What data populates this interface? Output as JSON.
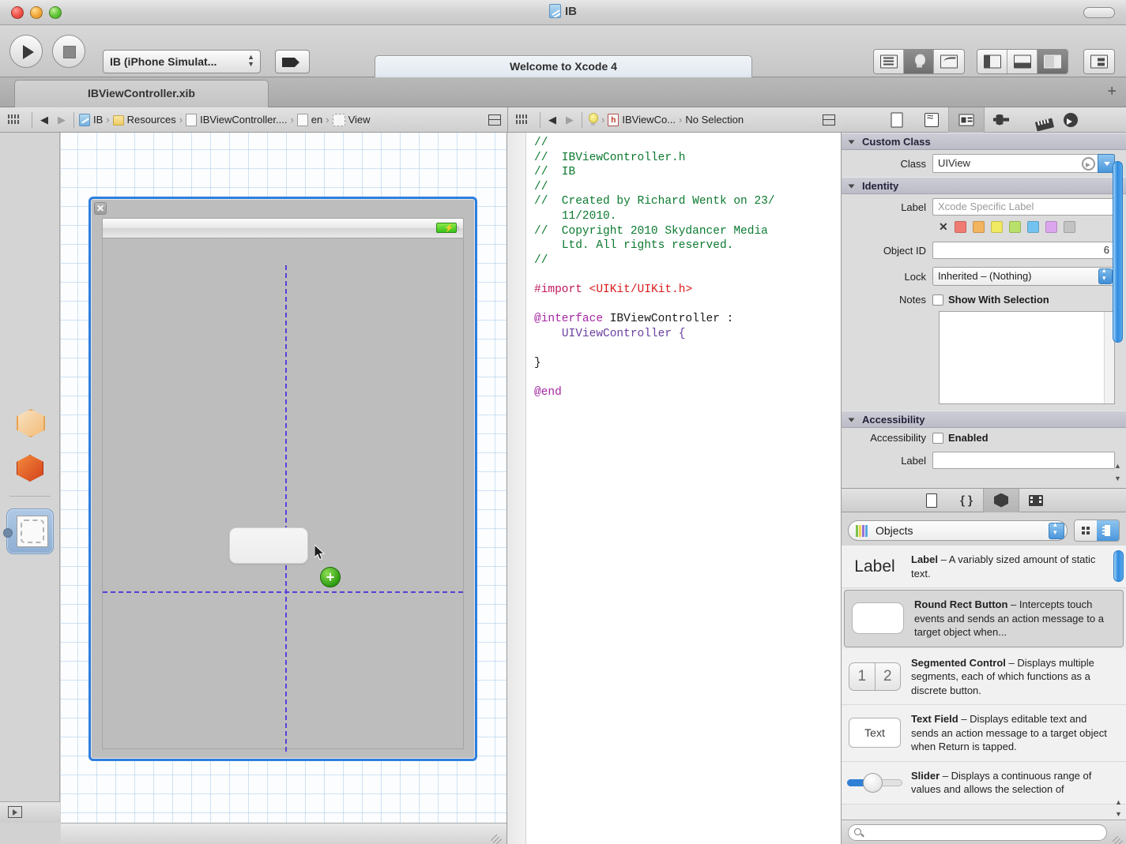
{
  "window": {
    "title": "IB",
    "traffic_lights": [
      "close",
      "minimize",
      "zoom"
    ]
  },
  "toolbar": {
    "run_label": "Run",
    "stop_label": "Stop",
    "scheme": "IB (iPhone Simulat...",
    "breakpoints_label": "Breakpoints",
    "activity": "Welcome to Xcode 4",
    "editor_segments": [
      {
        "name": "standard-editor",
        "icon": "lines-icon",
        "active": false
      },
      {
        "name": "assistant-editor",
        "icon": "bulb-icon",
        "active": true
      },
      {
        "name": "version-editor",
        "icon": "curve-icon",
        "active": false
      }
    ],
    "view_segments": [
      {
        "name": "navigator-toggle",
        "icon": "left-pane-icon",
        "active": false
      },
      {
        "name": "debug-toggle",
        "icon": "bottom-pane-icon",
        "active": false
      },
      {
        "name": "utilities-toggle",
        "icon": "right-pane-icon",
        "active": true
      }
    ],
    "organizer_label": "Organizer"
  },
  "tabs": {
    "active_tab": "IBViewController.xib",
    "add_label": "+"
  },
  "jump_bar_canvas": {
    "back": "◀",
    "forward": "▶",
    "crumbs": [
      {
        "label": "IB",
        "icon": "project-icon"
      },
      {
        "label": "Resources",
        "icon": "folder-icon"
      },
      {
        "label": "IBViewController....",
        "icon": "file-icon"
      },
      {
        "label": "en",
        "icon": "file-icon"
      },
      {
        "label": "View",
        "icon": "view-object-icon"
      }
    ]
  },
  "jump_bar_assistant": {
    "back": "◀",
    "forward": "▶",
    "crumbs": [
      {
        "label": "",
        "icon": "lightbulb-icon"
      },
      {
        "label": "IBViewCo...",
        "icon": "header-file-icon"
      },
      {
        "label": "No Selection",
        "icon": ""
      }
    ]
  },
  "canvas": {
    "dock_items": [
      {
        "name": "files-owner",
        "icon": "wireframe-cube-icon"
      },
      {
        "name": "first-responder",
        "icon": "orange-cube-icon"
      },
      {
        "name": "view-object",
        "icon": "view-placeholder-icon",
        "selected": true
      }
    ],
    "close_badge": "✕",
    "status_bar": {
      "battery_icon": "⚡"
    },
    "drag_badge": "+",
    "guides": {
      "vertical": true,
      "horizontal": true,
      "color": "#5b3fd8"
    },
    "selection_color": "#2d7fe0"
  },
  "assistant_editor": {
    "code_lines": [
      {
        "text": "//",
        "type": "comment"
      },
      {
        "text": "//  IBViewController.h",
        "type": "comment"
      },
      {
        "text": "//  IB",
        "type": "comment"
      },
      {
        "text": "//",
        "type": "comment"
      },
      {
        "text": "//  Created by Richard Wentk on 23/",
        "type": "comment"
      },
      {
        "text": "    11/2010.",
        "type": "comment"
      },
      {
        "text": "//  Copyright 2010 Skydancer Media",
        "type": "comment"
      },
      {
        "text": "    Ltd. All rights reserved.",
        "type": "comment"
      },
      {
        "text": "//",
        "type": "comment"
      }
    ],
    "import_directive": "#import",
    "import_target": "<UIKit/UIKit.h>",
    "interface_keyword": "@interface",
    "interface_name": "IBViewController",
    "interface_colon": ":",
    "superclass": "UIViewController {",
    "close_brace": "}",
    "end_keyword": "@end"
  },
  "inspector": {
    "tabs": [
      {
        "name": "file-inspector",
        "icon": "file-icon",
        "active": false
      },
      {
        "name": "quick-help-inspector",
        "icon": "help-icon",
        "active": false
      },
      {
        "name": "identity-inspector",
        "icon": "identity-icon",
        "active": true
      },
      {
        "name": "attributes-inspector",
        "icon": "attributes-icon",
        "active": false
      },
      {
        "name": "size-inspector",
        "icon": "ruler-icon",
        "active": false
      },
      {
        "name": "connections-inspector",
        "icon": "arrow-circle-icon",
        "active": false
      }
    ],
    "custom_class": {
      "header": "Custom Class",
      "class_label": "Class",
      "class_value": "UIView"
    },
    "identity": {
      "header": "Identity",
      "label_label": "Label",
      "label_placeholder": "Xcode Specific Label",
      "label_value": "",
      "swatch_clear": "✕",
      "swatches": [
        "#ef7b72",
        "#f3b45f",
        "#f0ea62",
        "#b9e06a",
        "#74c2ef",
        "#dca6ee",
        "#c3c3c3"
      ],
      "object_id_label": "Object ID",
      "object_id_value": "6",
      "lock_label": "Lock",
      "lock_value": "Inherited – (Nothing)",
      "notes_label": "Notes",
      "notes_checkbox_label": "Show With Selection",
      "notes_value": ""
    },
    "accessibility": {
      "header": "Accessibility",
      "enabled_row_label": "Accessibility",
      "enabled_checkbox_label": "Enabled",
      "label_label": "Label",
      "label_value": ""
    }
  },
  "library": {
    "tabs": [
      {
        "name": "file-template-library",
        "icon": "file-icon",
        "active": false
      },
      {
        "name": "code-snippet-library",
        "icon": "braces-icon",
        "active": false
      },
      {
        "name": "object-library",
        "icon": "cube-icon",
        "active": true
      },
      {
        "name": "media-library",
        "icon": "film-icon",
        "active": false
      }
    ],
    "selector_value": "Objects",
    "view_modes": [
      {
        "name": "grid-view",
        "active": false
      },
      {
        "name": "list-view",
        "active": true
      }
    ],
    "items": [
      {
        "name": "Label",
        "preview": "Label",
        "preview_type": "label",
        "description": " – A variably sized amount of static text.",
        "selected": false
      },
      {
        "name": "Round Rect Button",
        "preview": "",
        "preview_type": "round-rect-button",
        "description": " – Intercepts touch events and sends an action message to a target object when...",
        "selected": true
      },
      {
        "name": "Segmented Control",
        "preview": "1 2",
        "preview_type": "segmented",
        "description": " – Displays multiple segments, each of which functions as a discrete button.",
        "selected": false
      },
      {
        "name": "Text Field",
        "preview": "Text",
        "preview_type": "text-field",
        "description": " – Displays editable text and sends an action message to a target object when Return is tapped.",
        "selected": false
      },
      {
        "name": "Slider",
        "preview": "",
        "preview_type": "slider",
        "description": " – Displays a continuous range of values and allows the selection of",
        "selected": false
      }
    ],
    "search_placeholder": ""
  }
}
